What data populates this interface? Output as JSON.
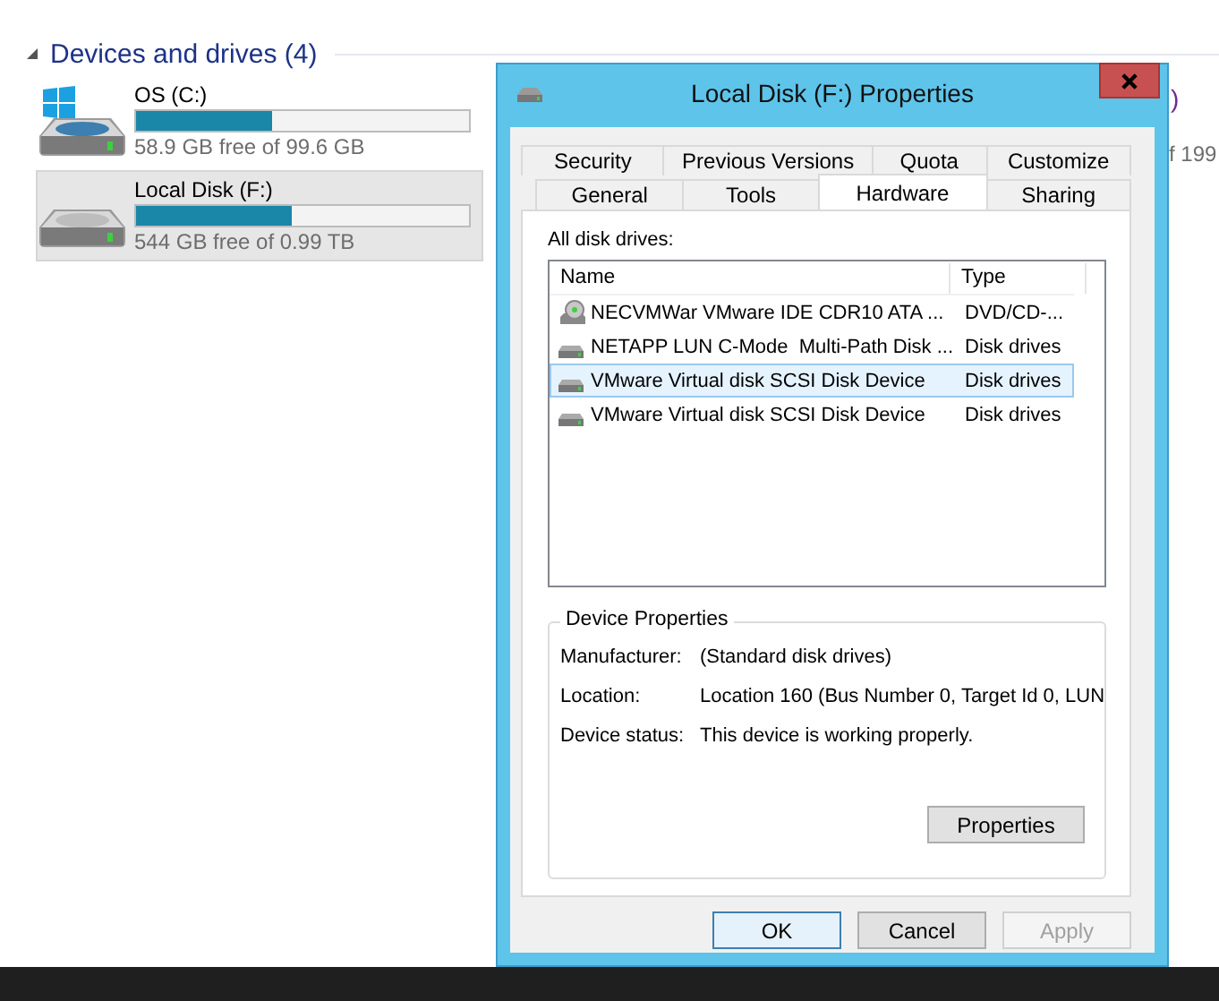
{
  "explorer": {
    "section": {
      "title": "Devices and drives (4)",
      "expanded": true
    },
    "drives": [
      {
        "kind": "system",
        "name": "OS (C:)",
        "level": 0.41,
        "free": "58.9 GB free of 99.6 GB",
        "selected": false
      },
      {
        "kind": "disk",
        "name": "Local Disk (F:)",
        "level": 0.47,
        "free": "544 GB free of 0.99 TB",
        "selected": true
      }
    ],
    "fragments": [
      ")",
      "f 199"
    ]
  },
  "dialog": {
    "title": "Local Disk (F:) Properties",
    "tab_rows": [
      [
        {
          "label": "Security",
          "selected": false
        },
        {
          "label": "Previous Versions",
          "selected": false
        },
        {
          "label": "Quota",
          "selected": false
        },
        {
          "label": "Customize",
          "selected": false
        }
      ],
      [
        {
          "label": "General",
          "selected": false
        },
        {
          "label": "Tools",
          "selected": false
        },
        {
          "label": "Hardware",
          "selected": true
        },
        {
          "label": "Sharing",
          "selected": false
        }
      ]
    ],
    "list_label": "All disk drives:",
    "columns": [
      "Name",
      "Type"
    ],
    "rows": [
      {
        "kind": "cdrom",
        "name": "NECVMWar VMware IDE CDR10 ATA ...",
        "type": "DVD/CD-...",
        "selected": false
      },
      {
        "kind": "disk",
        "name": "NETAPP LUN C-Mode  Multi-Path Disk ...",
        "type": "Disk drives",
        "selected": false
      },
      {
        "kind": "disk",
        "name": "VMware Virtual disk SCSI Disk Device",
        "type": "Disk drives",
        "selected": true
      },
      {
        "kind": "disk",
        "name": "VMware Virtual disk SCSI Disk Device",
        "type": "Disk drives",
        "selected": false
      }
    ],
    "group": {
      "title": "Device Properties",
      "fields": [
        {
          "label": "Manufacturer:",
          "value": "(Standard disk drives)"
        },
        {
          "label": "Location:",
          "value": "Location 160 (Bus Number 0, Target Id 0, LUN"
        },
        {
          "label": "Device status:",
          "value": "This device is working properly."
        }
      ],
      "button": "Properties"
    },
    "buttons": [
      {
        "label": "OK",
        "default": true,
        "disabled": false
      },
      {
        "label": "Cancel",
        "default": false,
        "disabled": false
      },
      {
        "label": "Apply",
        "default": false,
        "disabled": true
      }
    ]
  }
}
